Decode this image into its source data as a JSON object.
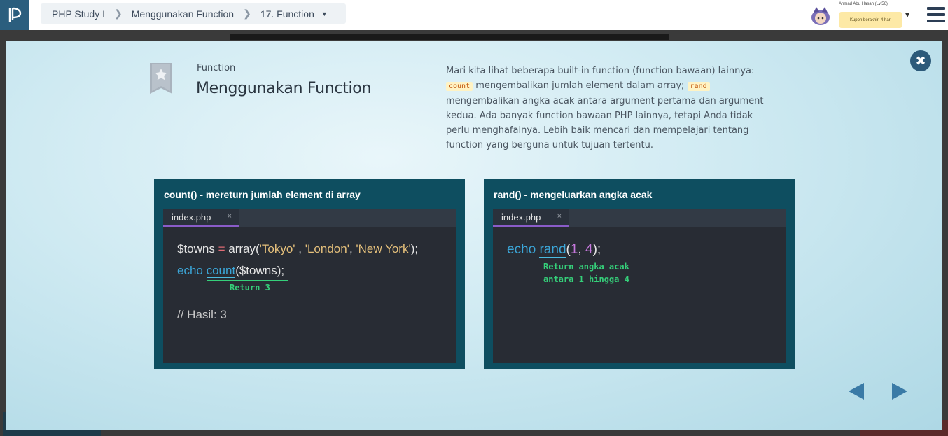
{
  "breadcrumb": {
    "course": "PHP Study I",
    "chapter": "Menggunakan Function",
    "lesson": "17. Function"
  },
  "user": {
    "name": "Ahmad Abu Hasan (Lv.56)",
    "coupon": "Kupon berakhir: 4 hari"
  },
  "slide": {
    "category": "Function",
    "title": "Menggunakan Function",
    "description": {
      "p1": "Mari kita lihat beberapa built-in function (function bawaan) lainnya:",
      "code1": "count",
      "p2": " mengembalikan jumlah element dalam array; ",
      "code2": "rand",
      "p3": " mengembalikan angka acak antara argument pertama dan argument kedua. Ada banyak function bawaan PHP lainnya, tetapi Anda tidak perlu menghafalnya. Lebih baik mencari dan mempelajari tentang function yang berguna untuk tujuan tertentu."
    },
    "cards": [
      {
        "title": "count() - mereturn jumlah element di array",
        "tab": "index.php",
        "code": {
          "var": "$towns",
          "eq": " = ",
          "fn": "array(",
          "s1": "'Tokyo'",
          "c1": " , ",
          "s2": "'London'",
          "c2": ", ",
          "s3": "'New York'",
          "end": ");",
          "echo": "echo ",
          "call": "count",
          "arg": "($towns);",
          "comment": "// Hasil: 3"
        },
        "note": "Return 3"
      },
      {
        "title": "rand() - mengeluarkan angka acak",
        "tab": "index.php",
        "code": {
          "echo": "echo ",
          "call": "rand",
          "open": "(",
          "n1": "1",
          "comma": ", ",
          "n2": "4",
          "close": ");"
        },
        "note_line1": "Return angka acak",
        "note_line2": "antara 1 hingga 4"
      }
    ]
  },
  "colors": {
    "accent": "#2c5a7a",
    "card_bg": "#0e4e60",
    "editor_bg": "#282c34",
    "note_green": "#35d07a"
  }
}
